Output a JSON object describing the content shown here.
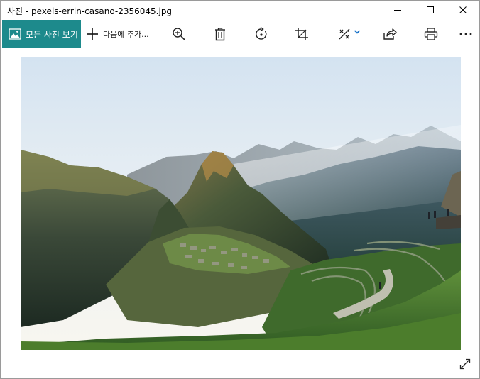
{
  "window": {
    "title": "사진 - pexels-errin-casano-2356045.jpg"
  },
  "toolbar": {
    "all_photos_label": "모든 사진 보기",
    "add_to_label": "다음에 추가..."
  },
  "icons": {
    "titlebar": [
      "minimize-icon",
      "maximize-icon",
      "close-icon"
    ],
    "toolbar": [
      "zoom-in-icon",
      "delete-icon",
      "rotate-icon",
      "crop-icon",
      "edit-icon",
      "share-icon",
      "print-icon",
      "more-icon"
    ],
    "viewer": [
      "fullscreen-icon"
    ]
  },
  "colors": {
    "accent": "#1d8a8c",
    "chevron": "#1a73c8"
  }
}
